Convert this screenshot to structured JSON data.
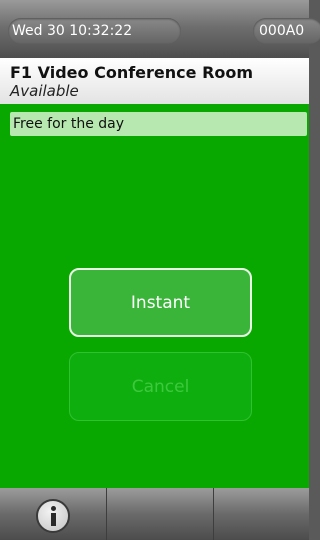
{
  "topbar": {
    "datetime": "Wed 30   10:32:22",
    "device_id": "000A0"
  },
  "room": {
    "name": "F1 Video Conference Room",
    "status": "Available"
  },
  "schedule": {
    "free_text": "Free for the day"
  },
  "actions": {
    "instant_label": "Instant",
    "cancel_label": "Cancel"
  },
  "bottombar": {
    "icons": [
      "info-icon"
    ]
  },
  "colors": {
    "available_green": "#09a800",
    "free_bar": "#b6e8b0"
  }
}
